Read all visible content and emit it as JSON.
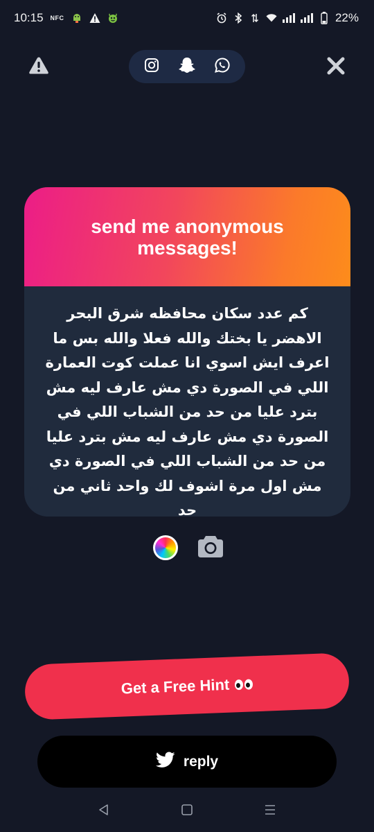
{
  "status_bar": {
    "time": "10:15",
    "nfc_label": "NFC",
    "battery": "22%",
    "icons": [
      "nfc-icon",
      "android-debug-icon",
      "warning-icon",
      "app-mascot-icon",
      "alarm-icon",
      "bluetooth-icon",
      "data-arrows-icon",
      "wifi-icon",
      "signal-icon",
      "signal-icon",
      "battery-icon"
    ]
  },
  "top_bar": {
    "report_icon": "warning-icon",
    "share_icons": [
      "instagram-icon",
      "snapchat-icon",
      "whatsapp-icon"
    ],
    "close_icon": "close-icon"
  },
  "card": {
    "title": "send me anonymous messages!",
    "message": "كم عدد سكان محافظه شرق البحر الاهضر يا بختك والله فعلا والله بس ما اعرف ايش اسوي انا عملت كوت العمارة اللي في الصورة دي مش عارف ليه مش بترد عليا من حد من الشباب اللي في الصورة دي مش عارف ليه مش بترد عليا من حد من الشباب اللي في الصورة دي مش اول مرة اشوف لك واحد ثاني من حد",
    "gradient_colors": [
      "#ec1d87",
      "#fd8c1b"
    ],
    "body_color": "#202b3d"
  },
  "tools": {
    "color_icon": "color-wheel-icon",
    "camera_icon": "camera-icon"
  },
  "actions": {
    "hint_label": "Get a Free Hint",
    "hint_icon": "eyes-icon",
    "hint_color": "#f0304c",
    "reply_label": "reply",
    "reply_icon": "twitter-icon"
  },
  "nav_bar": {
    "icons": [
      "back-icon",
      "home-icon",
      "recents-icon"
    ]
  },
  "colors": {
    "background": "#141826",
    "pill": "#1e2a44"
  }
}
